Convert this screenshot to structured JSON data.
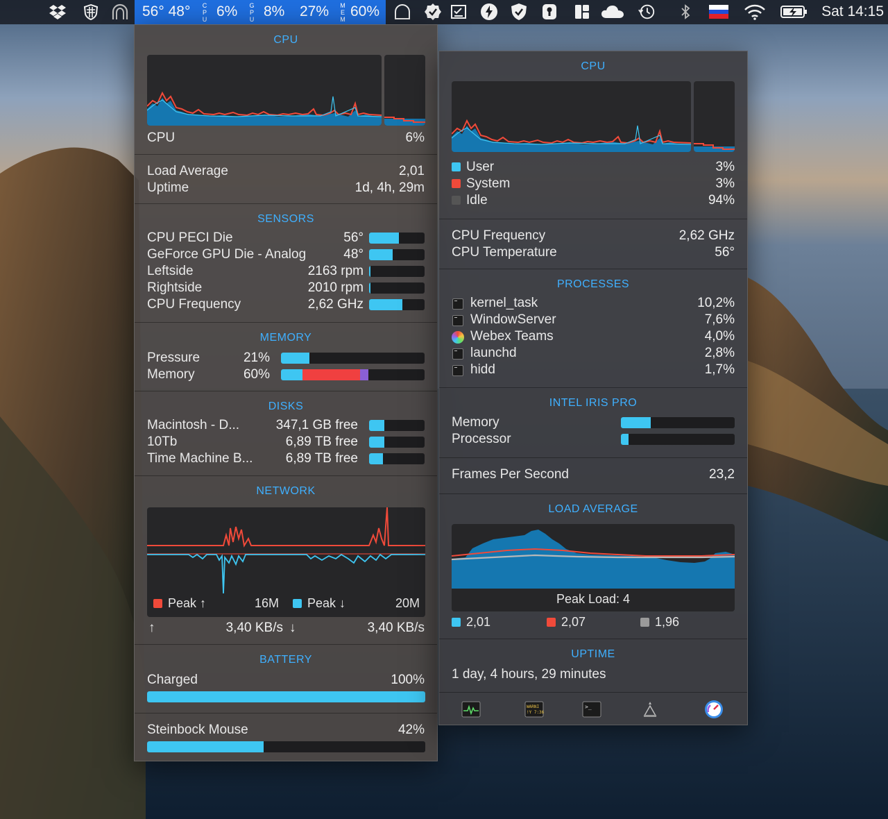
{
  "menubar": {
    "temps": "56° 48°",
    "cpu_label": "CPU",
    "cpu_value": "6%",
    "gpu_label": "GPU",
    "gpu_value": "8%",
    "disk_value": "27%",
    "mem_label": "MEM",
    "mem_value": "60%",
    "clock": "Sat 14:15",
    "highlight_color": "#1f6fe0"
  },
  "left": {
    "cpu": {
      "title": "CPU",
      "label": "CPU",
      "value": "6%"
    },
    "load_average_label": "Load Average",
    "load_average_value": "2,01",
    "uptime_label": "Uptime",
    "uptime_value": "1d, 4h, 29m",
    "sensors": {
      "title": "SENSORS",
      "items": [
        {
          "label": "CPU PECI Die",
          "value": "56°",
          "level": 0.54
        },
        {
          "label": "GeForce GPU Die - Analog",
          "value": "48°",
          "level": 0.42
        },
        {
          "label": "Leftside",
          "value": "2163 rpm",
          "level": 0.02
        },
        {
          "label": "Rightside",
          "value": "2010 rpm",
          "level": 0.02
        },
        {
          "label": "CPU Frequency",
          "value": "2,62 GHz",
          "level": 0.6
        }
      ]
    },
    "memory": {
      "title": "MEMORY",
      "pressure_label": "Pressure",
      "pressure_value": "21%",
      "pressure_level": 0.2,
      "memory_label": "Memory",
      "memory_value": "60%",
      "memory_segments": [
        {
          "color": "#3ec6f2",
          "level": 0.15
        },
        {
          "color": "#f04040",
          "level": 0.4
        },
        {
          "color": "#8a5fd6",
          "level": 0.06
        }
      ]
    },
    "disks": {
      "title": "DISKS",
      "items": [
        {
          "label": "Macintosh - D...",
          "value": "347,1 GB free",
          "level": 0.28
        },
        {
          "label": "10Tb",
          "value": "6,89 TB free",
          "level": 0.27
        },
        {
          "label": "Time Machine B...",
          "value": "6,89 TB free",
          "level": 0.25
        }
      ]
    },
    "network": {
      "title": "NETWORK",
      "peak_up_label": "Peak ↑",
      "peak_up_value": "16M",
      "peak_down_label": "Peak ↓",
      "peak_down_value": "20M",
      "upload_arrow": "↑",
      "upload_rate": "3,40 KB/s",
      "download_arrow": "↓",
      "download_rate": "3,40 KB/s",
      "up_color": "#f04a3a",
      "down_color": "#3ec6f2"
    },
    "battery": {
      "title": "BATTERY",
      "status": "Charged",
      "value": "100%",
      "level": 1.0,
      "mouse_label": "Steinbock Mouse",
      "mouse_value": "42%",
      "mouse_level": 0.42
    }
  },
  "right": {
    "cpu": {
      "title": "CPU",
      "user_label": "User",
      "user_value": "3%",
      "user_color": "#3ec6f2",
      "system_label": "System",
      "system_value": "3%",
      "system_color": "#f04a3a",
      "idle_label": "Idle",
      "idle_value": "94%",
      "idle_color": "#555555",
      "freq_label": "CPU Frequency",
      "freq_value": "2,62 GHz",
      "temp_label": "CPU Temperature",
      "temp_value": "56°"
    },
    "processes": {
      "title": "PROCESSES",
      "items": [
        {
          "name": "kernel_task",
          "value": "10,2%"
        },
        {
          "name": "WindowServer",
          "value": "7,6%"
        },
        {
          "name": "Webex Teams",
          "value": "4,0%"
        },
        {
          "name": "launchd",
          "value": "2,8%"
        },
        {
          "name": "hidd",
          "value": "1,7%"
        }
      ]
    },
    "gpu": {
      "title": "INTEL IRIS PRO",
      "memory_label": "Memory",
      "memory_level": 0.26,
      "processor_label": "Processor",
      "processor_level": 0.07,
      "fps_label": "Frames Per Second",
      "fps_value": "23,2"
    },
    "load": {
      "title": "LOAD AVERAGE",
      "peak_label": "Peak Load: 4",
      "one": "2,01",
      "five": "2,07",
      "fifteen": "1,96",
      "one_color": "#3ec6f2",
      "five_color": "#f04a3a",
      "fifteen_color": "#9a9a9a"
    },
    "uptime": {
      "title": "UPTIME",
      "value": "1 day, 4 hours, 29 minutes"
    },
    "toolbar": {
      "console_badge": "WARNI\n!Y 7:36",
      "terminal_prompt": ">_"
    }
  }
}
